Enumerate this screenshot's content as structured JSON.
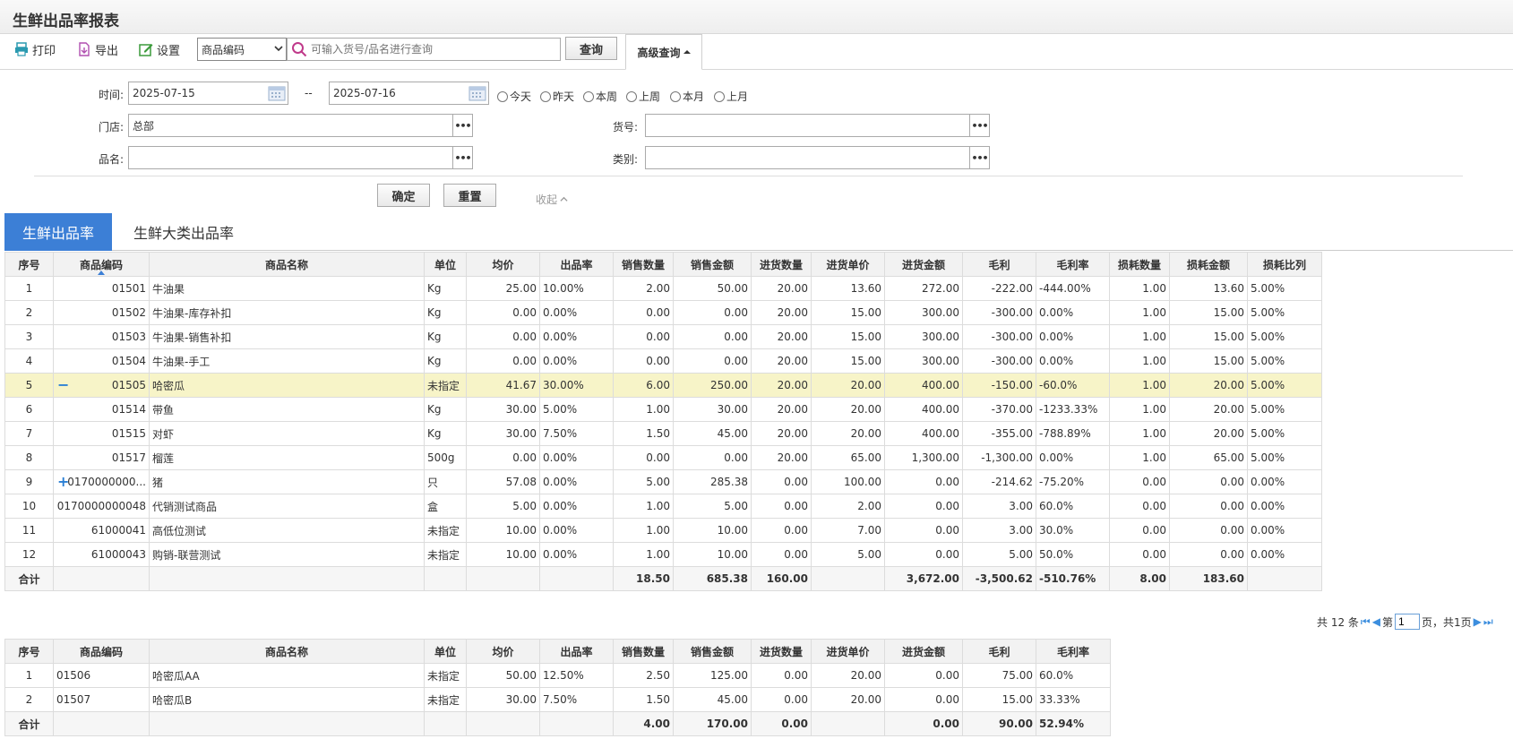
{
  "header": {
    "title": "生鲜出品率报表"
  },
  "toolbar": {
    "print": "打印",
    "export": "导出",
    "settings": "设置",
    "select_value": "商品编码",
    "search_placeholder": "可输入货号/品名进行查询",
    "query": "查询",
    "advanced": "高级查询"
  },
  "filters": {
    "time_label": "时间:",
    "date_from": "2025-07-15",
    "date_sep": "--",
    "date_to": "2025-07-16",
    "quick": [
      "今天",
      "昨天",
      "本周",
      "上周",
      "本月",
      "上月"
    ],
    "store_label": "门店:",
    "store_value": "总部",
    "sku_label": "货号:",
    "sku_value": "",
    "name_label": "品名:",
    "name_value": "",
    "category_label": "类别:",
    "category_value": "",
    "confirm": "确定",
    "reset": "重置",
    "collapse": "收起"
  },
  "tabs": [
    "生鲜出品率",
    "生鲜大类出品率"
  ],
  "main_table": {
    "headers": [
      "序号",
      "商品编码",
      "商品名称",
      "单位",
      "均价",
      "出品率",
      "销售数量",
      "销售金额",
      "进货数量",
      "进货单价",
      "进货金额",
      "毛利",
      "毛利率",
      "损耗数量",
      "损耗金额",
      "损耗比列"
    ],
    "rows": [
      [
        "1",
        "01501",
        "牛油果",
        "Kg",
        "25.00",
        "10.00%",
        "2.00",
        "50.00",
        "20.00",
        "13.60",
        "272.00",
        "-222.00",
        "-444.00%",
        "1.00",
        "13.60",
        "5.00%"
      ],
      [
        "2",
        "01502",
        "牛油果-库存补扣",
        "Kg",
        "0.00",
        "0.00%",
        "0.00",
        "0.00",
        "20.00",
        "15.00",
        "300.00",
        "-300.00",
        "0.00%",
        "1.00",
        "15.00",
        "5.00%"
      ],
      [
        "3",
        "01503",
        "牛油果-销售补扣",
        "Kg",
        "0.00",
        "0.00%",
        "0.00",
        "0.00",
        "20.00",
        "15.00",
        "300.00",
        "-300.00",
        "0.00%",
        "1.00",
        "15.00",
        "5.00%"
      ],
      [
        "4",
        "01504",
        "牛油果-手工",
        "Kg",
        "0.00",
        "0.00%",
        "0.00",
        "0.00",
        "20.00",
        "15.00",
        "300.00",
        "-300.00",
        "0.00%",
        "1.00",
        "15.00",
        "5.00%"
      ],
      [
        "5",
        "01505",
        "哈密瓜",
        "未指定",
        "41.67",
        "30.00%",
        "6.00",
        "250.00",
        "20.00",
        "20.00",
        "400.00",
        "-150.00",
        "-60.0%",
        "1.00",
        "20.00",
        "5.00%"
      ],
      [
        "6",
        "01514",
        "带鱼",
        "Kg",
        "30.00",
        "5.00%",
        "1.00",
        "30.00",
        "20.00",
        "20.00",
        "400.00",
        "-370.00",
        "-1233.33%",
        "1.00",
        "20.00",
        "5.00%"
      ],
      [
        "7",
        "01515",
        "对虾",
        "Kg",
        "30.00",
        "7.50%",
        "1.50",
        "45.00",
        "20.00",
        "20.00",
        "400.00",
        "-355.00",
        "-788.89%",
        "1.00",
        "20.00",
        "5.00%"
      ],
      [
        "8",
        "01517",
        "榴莲",
        "500g",
        "0.00",
        "0.00%",
        "0.00",
        "0.00",
        "20.00",
        "65.00",
        "1,300.00",
        "-1,300.00",
        "0.00%",
        "1.00",
        "65.00",
        "5.00%"
      ],
      [
        "9",
        "0170000000...",
        "猪",
        "只",
        "57.08",
        "0.00%",
        "5.00",
        "285.38",
        "0.00",
        "100.00",
        "0.00",
        "-214.62",
        "-75.20%",
        "0.00",
        "0.00",
        "0.00%"
      ],
      [
        "10",
        "0170000000048",
        "代销测试商品",
        "盒",
        "5.00",
        "0.00%",
        "1.00",
        "5.00",
        "0.00",
        "2.00",
        "0.00",
        "3.00",
        "60.0%",
        "0.00",
        "0.00",
        "0.00%"
      ],
      [
        "11",
        "61000041",
        "高低位测试",
        "未指定",
        "10.00",
        "0.00%",
        "1.00",
        "10.00",
        "0.00",
        "7.00",
        "0.00",
        "3.00",
        "30.0%",
        "0.00",
        "0.00",
        "0.00%"
      ],
      [
        "12",
        "61000043",
        "购销-联营测试",
        "未指定",
        "10.00",
        "0.00%",
        "1.00",
        "10.00",
        "0.00",
        "5.00",
        "0.00",
        "5.00",
        "50.0%",
        "0.00",
        "0.00",
        "0.00%"
      ]
    ],
    "totals": [
      "合计",
      "",
      "",
      "",
      "",
      "",
      "18.50",
      "685.38",
      "160.00",
      "",
      "3,672.00",
      "-3,500.62",
      "-510.76%",
      "8.00",
      "183.60",
      ""
    ]
  },
  "pager": {
    "total_prefix": "共 12 条",
    "page_prefix": "第",
    "page_value": "1",
    "page_suffix": "页，共1页"
  },
  "sub_table": {
    "headers": [
      "序号",
      "商品编码",
      "商品名称",
      "单位",
      "均价",
      "出品率",
      "销售数量",
      "销售金额",
      "进货数量",
      "进货单价",
      "进货金额",
      "毛利",
      "毛利率"
    ],
    "rows": [
      [
        "1",
        "01506",
        "哈密瓜AA",
        "未指定",
        "50.00",
        "12.50%",
        "2.50",
        "125.00",
        "0.00",
        "20.00",
        "0.00",
        "75.00",
        "60.0%"
      ],
      [
        "2",
        "01507",
        "哈密瓜B",
        "未指定",
        "30.00",
        "7.50%",
        "1.50",
        "45.00",
        "0.00",
        "20.00",
        "0.00",
        "15.00",
        "33.33%"
      ]
    ],
    "totals": [
      "合计",
      "",
      "",
      "",
      "",
      "",
      "4.00",
      "170.00",
      "0.00",
      "",
      "0.00",
      "90.00",
      "52.94%"
    ]
  },
  "colors": {
    "accent": "#3c7fd6",
    "highlight_row": "#f7f4c8"
  }
}
